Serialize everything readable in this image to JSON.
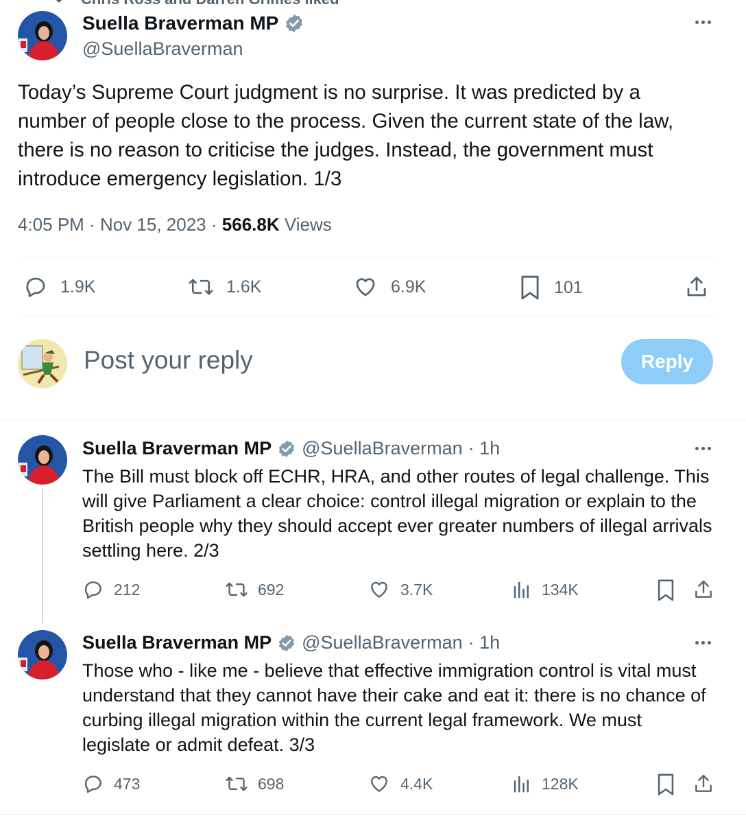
{
  "social_context": "Chris Ross and Darren Grimes liked",
  "main_tweet": {
    "author_name": "Suella Braverman MP",
    "handle": "@SuellaBraverman",
    "text": "Today’s Supreme Court judgment is no surprise. It was predicted by a number of people close to the process. Given the current state of the law, there is no reason to criticise the judges. Instead, the government must introduce emergency legislation. 1/3",
    "time": "4:05 PM",
    "date": "Nov 15, 2023",
    "views_count": "566.8K",
    "views_label": "Views",
    "separator": "·",
    "stats": {
      "replies": "1.9K",
      "reposts": "1.6K",
      "likes": "6.9K",
      "bookmarks": "101"
    }
  },
  "compose": {
    "placeholder": "Post your reply",
    "button_label": "Reply"
  },
  "replies": [
    {
      "author_name": "Suella Braverman MP",
      "handle": "@SuellaBraverman",
      "time": "· 1h",
      "text": "The Bill must block off ECHR, HRA, and other routes of legal challenge. This will give Parliament a clear choice: control illegal migration or explain to the British people why they should accept ever greater numbers of illegal arrivals settling here. 2/3",
      "stats": {
        "replies": "212",
        "reposts": "692",
        "likes": "3.7K",
        "views": "134K"
      }
    },
    {
      "author_name": "Suella Braverman MP",
      "handle": "@SuellaBraverman",
      "time": "· 1h",
      "text": "Those who - like me - believe that effective immigration control is vital must understand that they cannot have their cake and eat it: there is no chance of curbing illegal migration within the current legal framework. We must legislate or admit defeat. 3/3",
      "stats": {
        "replies": "473",
        "reposts": "698",
        "likes": "4.4K",
        "views": "128K"
      }
    }
  ],
  "colors": {
    "accent": "#1d9bf0",
    "reply_button_disabled": "#8ecdf7",
    "secondary_text": "#536471",
    "verified": "#829aab"
  },
  "icons": [
    "heart-icon",
    "verified-badge-icon",
    "more-icon",
    "reply-icon",
    "repost-icon",
    "like-icon",
    "bookmark-icon",
    "share-icon",
    "views-icon"
  ]
}
